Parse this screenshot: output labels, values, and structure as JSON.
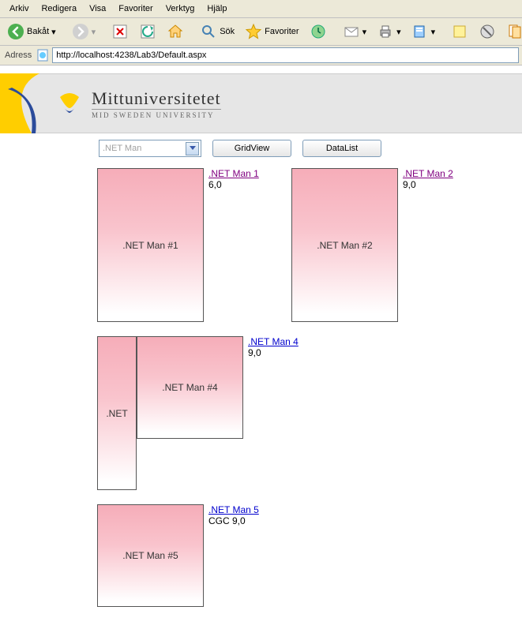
{
  "menu": {
    "items": [
      "Arkiv",
      "Redigera",
      "Visa",
      "Favoriter",
      "Verktyg",
      "Hjälp"
    ]
  },
  "toolbar": {
    "back_label": "Bakåt",
    "search_label": "Sök",
    "fav_label": "Favoriter"
  },
  "address": {
    "label": "Adress",
    "url": "http://localhost:4238/Lab3/Default.aspx"
  },
  "university": {
    "name": "Mittuniversitetet",
    "sub": "MID SWEDEN UNIVERSITY"
  },
  "controls": {
    "dropdown_value": ".NET Man",
    "button1": "GridView",
    "button2": "DataList"
  },
  "cards": [
    {
      "title": ".NET Man #1",
      "link": ".NET Man 1",
      "info": "6,0",
      "visited": true
    },
    {
      "title": ".NET Man #2",
      "link": ".NET Man 2",
      "info": "9,0",
      "visited": true
    },
    {
      "title": ".NET",
      "link": "",
      "info": "",
      "crop": true
    },
    {
      "title": ".NET Man #4",
      "link": ".NET Man 4",
      "info": "9,0",
      "visited": false
    },
    {
      "title": ".NET Man #5",
      "link": ".NET Man 5",
      "info": "CGC 9,0",
      "visited": false
    }
  ]
}
